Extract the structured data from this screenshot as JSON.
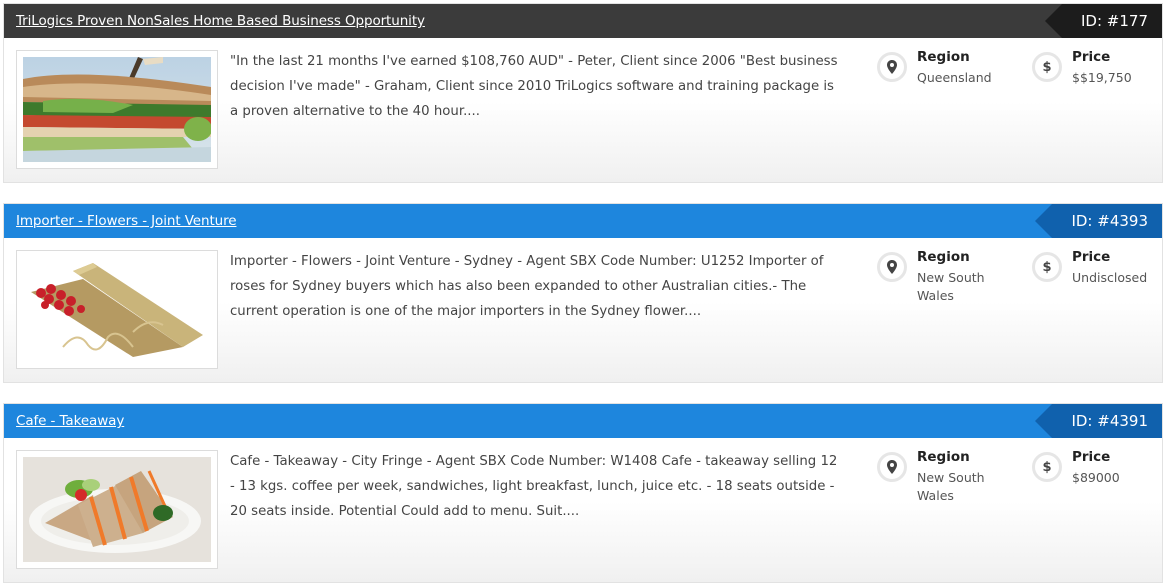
{
  "listings": [
    {
      "title": "TriLogics Proven NonSales Home Based Business Opportunity",
      "id_label": "ID: #177",
      "theme": "dark",
      "image": "sandwich-photo",
      "description": "\"In the last 21 months I've earned $108,760 AUD\" - Peter, Client since 2006 \"Best business decision I've made\" - Graham, Client since 2010 TriLogics software and training package is a proven alternative to the 40 hour....",
      "region_label": "Region",
      "region_value": "Queensland",
      "price_label": "Price",
      "price_value": "$$19,750"
    },
    {
      "title": "Importer - Flowers - Joint Venture",
      "id_label": "ID: #4393",
      "theme": "blue",
      "image": "roses-box-photo",
      "description": "Importer - Flowers - Joint Venture - Sydney - Agent SBX Code Number: U1252 Importer of roses for Sydney buyers which has also been expanded to other Australian cities.- The current operation is one of the major importers in the Sydney flower....",
      "region_label": "Region",
      "region_value": "New South Wales",
      "price_label": "Price",
      "price_value": "Undisclosed"
    },
    {
      "title": "Cafe - Takeaway",
      "id_label": "ID: #4391",
      "theme": "blue",
      "image": "sandwich-plate-photo",
      "description": "Cafe - Takeaway - City Fringe - Agent SBX Code Number: W1408 Cafe - takeaway selling 12 - 13 kgs. coffee per week, sandwiches, light breakfast, lunch, juice etc. - 18 seats outside - 20 seats inside. Potential Could add to menu. Suit....",
      "region_label": "Region",
      "region_value": "New South Wales",
      "price_label": "Price",
      "price_value": "$89000"
    }
  ],
  "icons": {
    "region": "map-pin-icon",
    "price": "dollar-icon",
    "price_glyph": "$"
  },
  "colors": {
    "dark_header": "#3b3b3b",
    "dark_id_tag": "#1c1c1c",
    "blue_header": "#1e86dd",
    "blue_id_tag": "#1061ad"
  }
}
